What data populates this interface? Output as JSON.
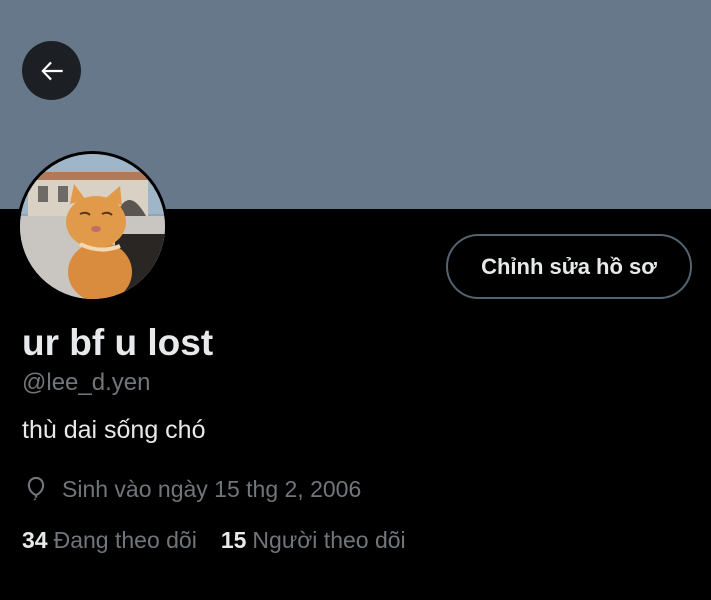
{
  "banner": {
    "color": "#66788a"
  },
  "nav": {
    "back_icon": "arrow-left-icon"
  },
  "avatar": {
    "description_icon": "cat-photo-avatar"
  },
  "profile": {
    "edit_button_label": "Chỉnh sửa hồ sơ",
    "display_name": "ur bf u lost",
    "handle": "@lee_d.yen",
    "bio": "thù dai sống chó",
    "birth_icon": "balloon-icon",
    "birth_text": "Sinh vào ngày 15 thg 2, 2006",
    "following_count": "34",
    "following_label": "Đang theo dõi",
    "followers_count": "15",
    "followers_label": "Người theo dõi"
  },
  "colors": {
    "background": "#000000",
    "text_primary": "#e7e9ea",
    "text_secondary": "#71767b",
    "border": "#536471"
  }
}
